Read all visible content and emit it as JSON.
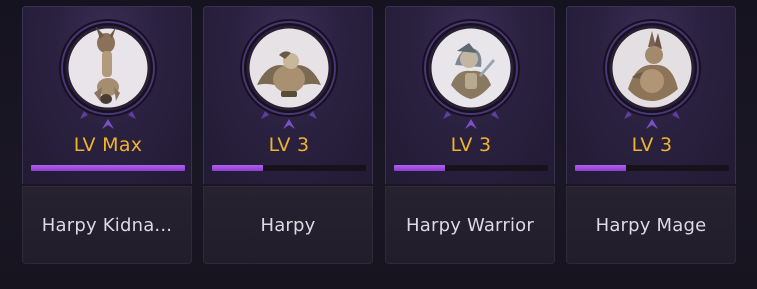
{
  "colors": {
    "level_text": "#f0b32a",
    "xp_fill": "#9b4ee0",
    "name_text": "#dcdae3",
    "frame_ring": "#1a1423",
    "frame_accent": "#6a45b0"
  },
  "monsters": [
    {
      "level": "LV Max",
      "xp_fraction": 1.0,
      "name": "Harpy Kidna...",
      "portrait_icon": "harpy-kidnapper-portrait-icon"
    },
    {
      "level": "LV 3",
      "xp_fraction": 0.33,
      "name": "Harpy",
      "portrait_icon": "harpy-portrait-icon"
    },
    {
      "level": "LV 3",
      "xp_fraction": 0.33,
      "name": "Harpy Warrior",
      "portrait_icon": "harpy-warrior-portrait-icon"
    },
    {
      "level": "LV 3",
      "xp_fraction": 0.33,
      "name": "Harpy Mage",
      "portrait_icon": "harpy-mage-portrait-icon"
    }
  ]
}
